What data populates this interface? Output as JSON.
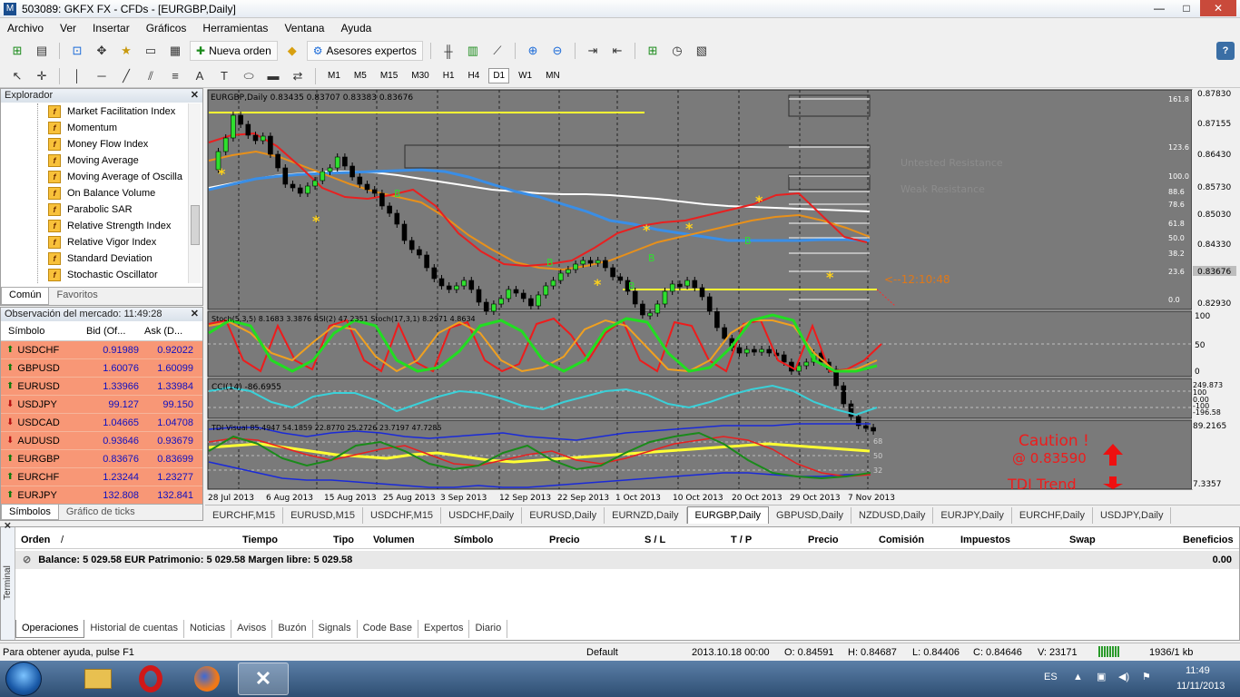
{
  "window": {
    "title": "503089: GKFX FX - CFDs - [EURGBP,Daily]",
    "minimize": "—",
    "maximize": "□",
    "close": "✕"
  },
  "menu": [
    "Archivo",
    "Ver",
    "Insertar",
    "Gráficos",
    "Herramientas",
    "Ventana",
    "Ayuda"
  ],
  "toolbar": {
    "new_order": "Nueva orden",
    "expert_advisors": "Asesores expertos",
    "timeframes": [
      "M1",
      "M5",
      "M15",
      "M30",
      "H1",
      "H4",
      "D1",
      "W1",
      "MN"
    ],
    "active_timeframe": "D1"
  },
  "explorer": {
    "title": "Explorador",
    "items": [
      "Market Facilitation Index",
      "Momentum",
      "Money Flow Index",
      "Moving Average",
      "Moving Average of Oscilla",
      "On Balance Volume",
      "Parabolic SAR",
      "Relative Strength Index",
      "Relative Vigor Index",
      "Standard Deviation",
      "Stochastic Oscillator"
    ],
    "tabs": [
      "Común",
      "Favoritos"
    ]
  },
  "market_watch": {
    "title": "Observación del mercado: 11:49:28",
    "col_symbol": "Símbolo",
    "col_bid": "Bid (Of...",
    "col_ask": "Ask (D...",
    "rows": [
      {
        "symbol": "USDCHF",
        "bid": "0.91989",
        "ask": "0.92022",
        "dir": "up"
      },
      {
        "symbol": "GBPUSD",
        "bid": "1.60076",
        "ask": "1.60099",
        "dir": "up"
      },
      {
        "symbol": "EURUSD",
        "bid": "1.33966",
        "ask": "1.33984",
        "dir": "up"
      },
      {
        "symbol": "USDJPY",
        "bid": "99.127",
        "ask": "99.150",
        "dir": "down"
      },
      {
        "symbol": "USDCAD",
        "bid": "1.04665",
        "ask": "1.04708",
        "dir": "down"
      },
      {
        "symbol": "AUDUSD",
        "bid": "0.93646",
        "ask": "0.93679",
        "dir": "down"
      },
      {
        "symbol": "EURGBP",
        "bid": "0.83676",
        "ask": "0.83699",
        "dir": "up"
      },
      {
        "symbol": "EURCHF",
        "bid": "1.23244",
        "ask": "1.23277",
        "dir": "up"
      },
      {
        "symbol": "EURJPY",
        "bid": "132.808",
        "ask": "132.841",
        "dir": "up"
      }
    ],
    "tabs": [
      "Símbolos",
      "Gráfico de ticks"
    ]
  },
  "chart": {
    "header": "EURGBP,Daily  0.83435 0.83707 0.83383 0.83676",
    "price_labels": [
      "0.87830",
      "0.87155",
      "0.86430",
      "0.85730",
      "0.85030",
      "0.84330",
      "0.83676",
      "0.82930"
    ],
    "fib_labels": [
      "161.8",
      "123.6",
      "100.0",
      "88.6",
      "78.6",
      "61.8",
      "50.0",
      "38.2",
      "23.6",
      "0.0"
    ],
    "zone_labels": [
      "Untested Resistance",
      "Weak Resistance"
    ],
    "countdown": "<--12:10:48",
    "stoch_header": "Stoch(5,3,5) 8.1683 3.3876  RSI(2) 47.2351  Stoch(17,3,1) 8.2971 4.8634",
    "stoch_scale": [
      "100",
      "50",
      "0"
    ],
    "cci_header": "CCI(14) -86.6955",
    "cci_scale": [
      "249.873",
      "100",
      "0.00",
      "-100",
      "-196.58"
    ],
    "tdi_header": "TDI Visual 85.4947 54.1859 22.8770 25.2726 23.7197 47.7285",
    "tdi_scale": [
      "89.2165",
      "7.3357"
    ],
    "tdi_levels": [
      "68",
      "50",
      "32"
    ],
    "caution": "Caution !",
    "caution_price": "@ 0.83590",
    "tdi_trend": "TDI Trend",
    "dates": [
      "28 Jul 2013",
      "6 Aug 2013",
      "15 Aug 2013",
      "25 Aug 2013",
      "3 Sep 2013",
      "12 Sep 2013",
      "22 Sep 2013",
      "1 Oct 2013",
      "10 Oct 2013",
      "20 Oct 2013",
      "29 Oct 2013",
      "7 Nov 2013"
    ],
    "b_marker": "B"
  },
  "chart_tabs": [
    "EURCHF,M15",
    "EURUSD,M15",
    "USDCHF,M15",
    "USDCHF,Daily",
    "EURUSD,Daily",
    "EURNZD,Daily",
    "EURGBP,Daily",
    "GBPUSD,Daily",
    "NZDUSD,Daily",
    "EURJPY,Daily",
    "EURCHF,Daily",
    "USDJPY,Daily"
  ],
  "active_chart_tab": "EURGBP,Daily",
  "terminal": {
    "side": "Terminal",
    "columns": [
      "Orden",
      "/",
      "Tiempo",
      "Tipo",
      "Volumen",
      "Símbolo",
      "Precio",
      "S / L",
      "T / P",
      "Precio",
      "Comisión",
      "Impuestos",
      "Swap",
      "Beneficios"
    ],
    "balance": "Balance: 5 029.58 EUR  Patrimonio: 5 029.58  Margen libre: 5 029.58",
    "profit": "0.00",
    "tabs": [
      "Operaciones",
      "Historial de cuentas",
      "Noticias",
      "Avisos",
      "Buzón",
      "Signals",
      "Code Base",
      "Expertos",
      "Diario"
    ]
  },
  "status": {
    "help": "Para obtener ayuda, pulse F1",
    "profile": "Default",
    "time": "2013.10.18 00:00",
    "open": "O: 0.84591",
    "high": "H: 0.84687",
    "low": "L: 0.84406",
    "close": "C: 0.84646",
    "volume": "V: 23171",
    "traffic": "1936/1 kb"
  },
  "taskbar": {
    "lang": "ES",
    "clock_time": "11:49",
    "clock_date": "11/11/2013"
  }
}
